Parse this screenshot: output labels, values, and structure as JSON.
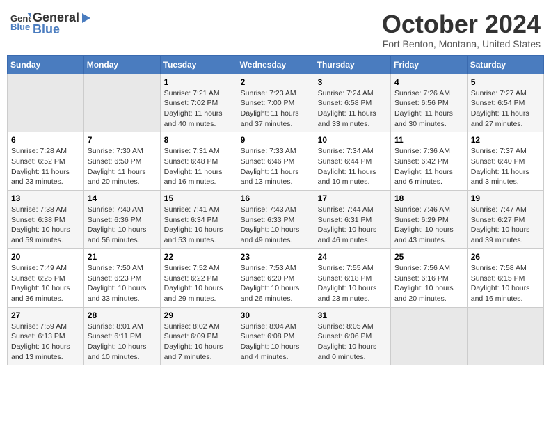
{
  "header": {
    "logo_line1": "General",
    "logo_line2": "Blue",
    "month": "October 2024",
    "location": "Fort Benton, Montana, United States"
  },
  "days_of_week": [
    "Sunday",
    "Monday",
    "Tuesday",
    "Wednesday",
    "Thursday",
    "Friday",
    "Saturday"
  ],
  "weeks": [
    [
      {
        "day": "",
        "info": ""
      },
      {
        "day": "",
        "info": ""
      },
      {
        "day": "1",
        "info": "Sunrise: 7:21 AM\nSunset: 7:02 PM\nDaylight: 11 hours and 40 minutes."
      },
      {
        "day": "2",
        "info": "Sunrise: 7:23 AM\nSunset: 7:00 PM\nDaylight: 11 hours and 37 minutes."
      },
      {
        "day": "3",
        "info": "Sunrise: 7:24 AM\nSunset: 6:58 PM\nDaylight: 11 hours and 33 minutes."
      },
      {
        "day": "4",
        "info": "Sunrise: 7:26 AM\nSunset: 6:56 PM\nDaylight: 11 hours and 30 minutes."
      },
      {
        "day": "5",
        "info": "Sunrise: 7:27 AM\nSunset: 6:54 PM\nDaylight: 11 hours and 27 minutes."
      }
    ],
    [
      {
        "day": "6",
        "info": "Sunrise: 7:28 AM\nSunset: 6:52 PM\nDaylight: 11 hours and 23 minutes."
      },
      {
        "day": "7",
        "info": "Sunrise: 7:30 AM\nSunset: 6:50 PM\nDaylight: 11 hours and 20 minutes."
      },
      {
        "day": "8",
        "info": "Sunrise: 7:31 AM\nSunset: 6:48 PM\nDaylight: 11 hours and 16 minutes."
      },
      {
        "day": "9",
        "info": "Sunrise: 7:33 AM\nSunset: 6:46 PM\nDaylight: 11 hours and 13 minutes."
      },
      {
        "day": "10",
        "info": "Sunrise: 7:34 AM\nSunset: 6:44 PM\nDaylight: 11 hours and 10 minutes."
      },
      {
        "day": "11",
        "info": "Sunrise: 7:36 AM\nSunset: 6:42 PM\nDaylight: 11 hours and 6 minutes."
      },
      {
        "day": "12",
        "info": "Sunrise: 7:37 AM\nSunset: 6:40 PM\nDaylight: 11 hours and 3 minutes."
      }
    ],
    [
      {
        "day": "13",
        "info": "Sunrise: 7:38 AM\nSunset: 6:38 PM\nDaylight: 10 hours and 59 minutes."
      },
      {
        "day": "14",
        "info": "Sunrise: 7:40 AM\nSunset: 6:36 PM\nDaylight: 10 hours and 56 minutes."
      },
      {
        "day": "15",
        "info": "Sunrise: 7:41 AM\nSunset: 6:34 PM\nDaylight: 10 hours and 53 minutes."
      },
      {
        "day": "16",
        "info": "Sunrise: 7:43 AM\nSunset: 6:33 PM\nDaylight: 10 hours and 49 minutes."
      },
      {
        "day": "17",
        "info": "Sunrise: 7:44 AM\nSunset: 6:31 PM\nDaylight: 10 hours and 46 minutes."
      },
      {
        "day": "18",
        "info": "Sunrise: 7:46 AM\nSunset: 6:29 PM\nDaylight: 10 hours and 43 minutes."
      },
      {
        "day": "19",
        "info": "Sunrise: 7:47 AM\nSunset: 6:27 PM\nDaylight: 10 hours and 39 minutes."
      }
    ],
    [
      {
        "day": "20",
        "info": "Sunrise: 7:49 AM\nSunset: 6:25 PM\nDaylight: 10 hours and 36 minutes."
      },
      {
        "day": "21",
        "info": "Sunrise: 7:50 AM\nSunset: 6:23 PM\nDaylight: 10 hours and 33 minutes."
      },
      {
        "day": "22",
        "info": "Sunrise: 7:52 AM\nSunset: 6:22 PM\nDaylight: 10 hours and 29 minutes."
      },
      {
        "day": "23",
        "info": "Sunrise: 7:53 AM\nSunset: 6:20 PM\nDaylight: 10 hours and 26 minutes."
      },
      {
        "day": "24",
        "info": "Sunrise: 7:55 AM\nSunset: 6:18 PM\nDaylight: 10 hours and 23 minutes."
      },
      {
        "day": "25",
        "info": "Sunrise: 7:56 AM\nSunset: 6:16 PM\nDaylight: 10 hours and 20 minutes."
      },
      {
        "day": "26",
        "info": "Sunrise: 7:58 AM\nSunset: 6:15 PM\nDaylight: 10 hours and 16 minutes."
      }
    ],
    [
      {
        "day": "27",
        "info": "Sunrise: 7:59 AM\nSunset: 6:13 PM\nDaylight: 10 hours and 13 minutes."
      },
      {
        "day": "28",
        "info": "Sunrise: 8:01 AM\nSunset: 6:11 PM\nDaylight: 10 hours and 10 minutes."
      },
      {
        "day": "29",
        "info": "Sunrise: 8:02 AM\nSunset: 6:09 PM\nDaylight: 10 hours and 7 minutes."
      },
      {
        "day": "30",
        "info": "Sunrise: 8:04 AM\nSunset: 6:08 PM\nDaylight: 10 hours and 4 minutes."
      },
      {
        "day": "31",
        "info": "Sunrise: 8:05 AM\nSunset: 6:06 PM\nDaylight: 10 hours and 0 minutes."
      },
      {
        "day": "",
        "info": ""
      },
      {
        "day": "",
        "info": ""
      }
    ]
  ]
}
